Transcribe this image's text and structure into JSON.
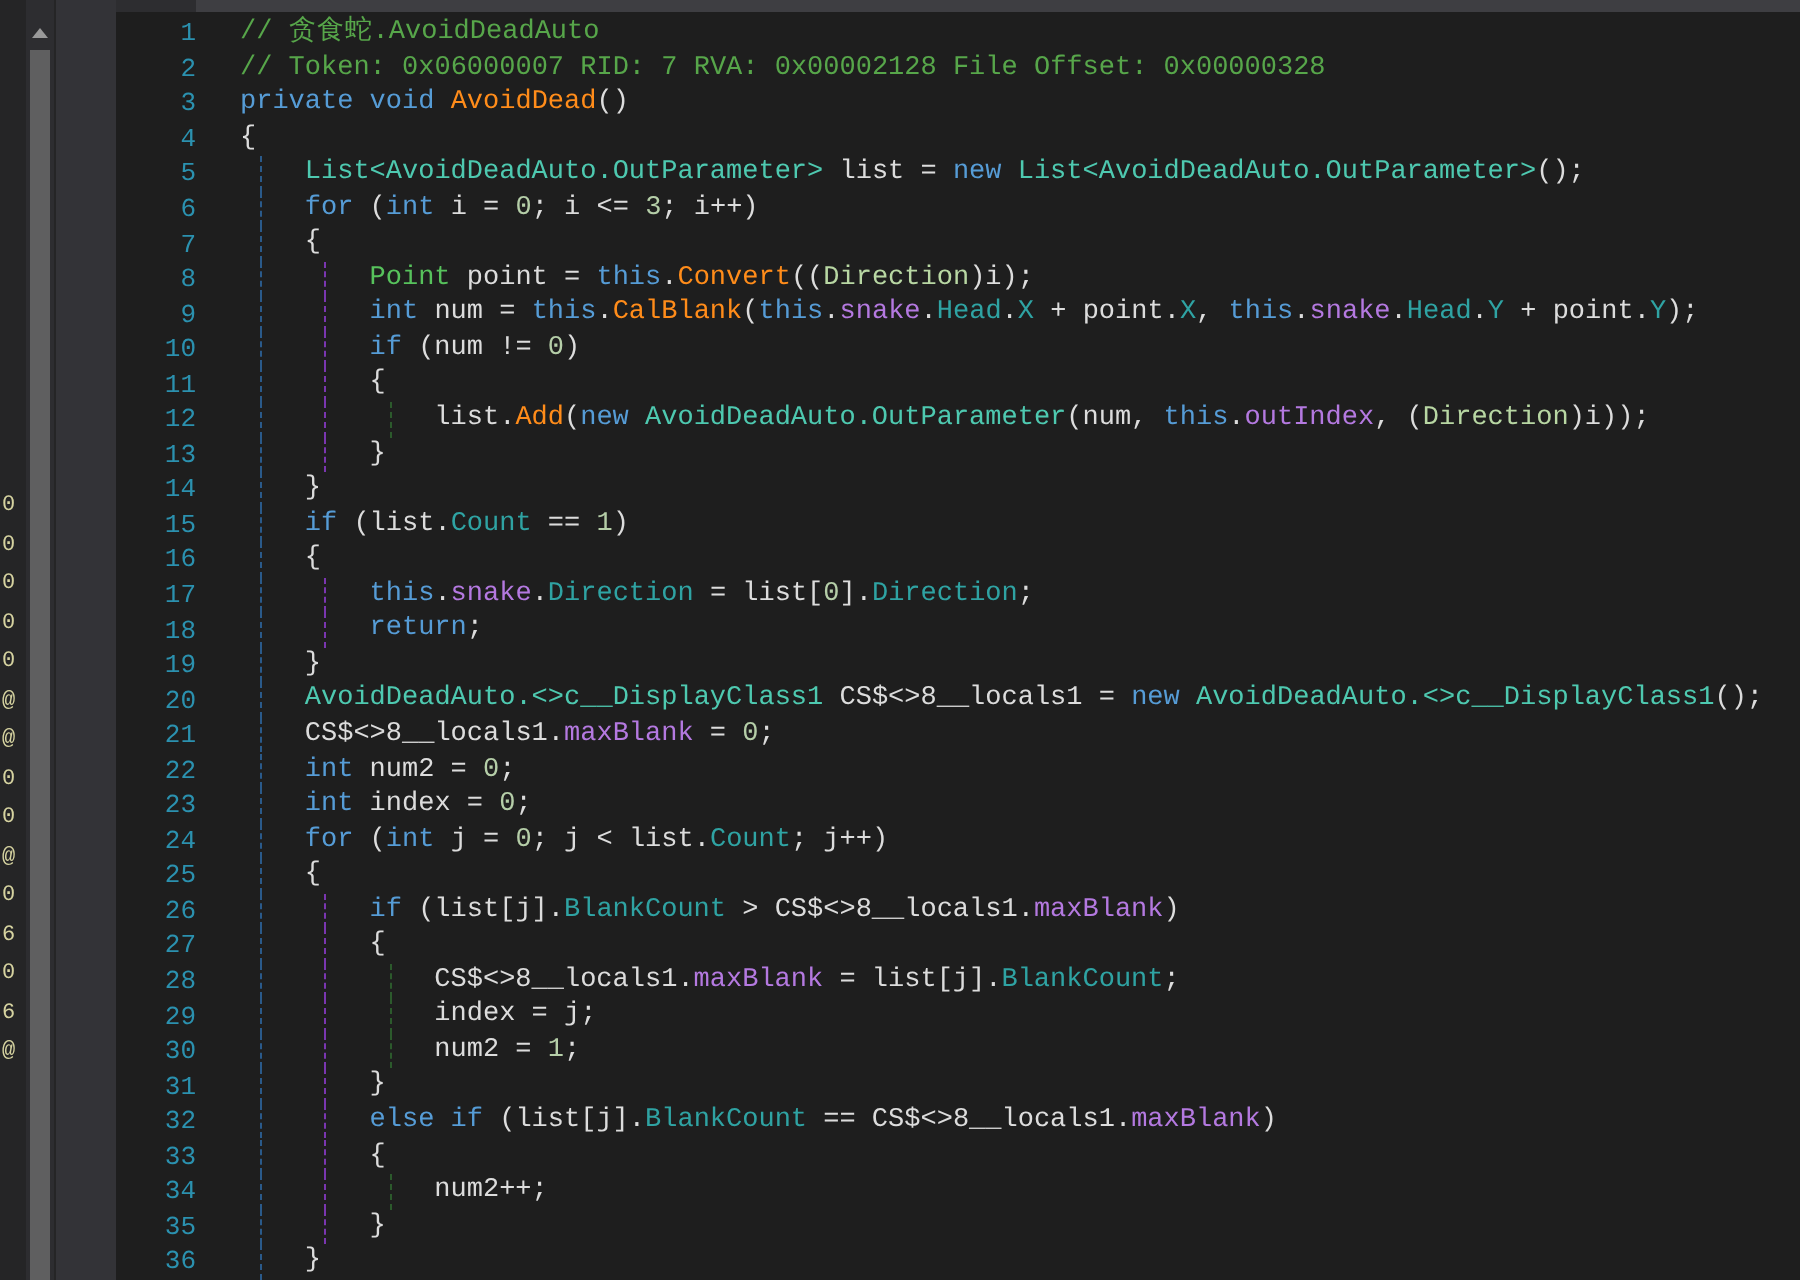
{
  "side_panel": {
    "fragments": [
      {
        "text": "0"
      },
      {
        "text": "0"
      },
      {
        "text": "0"
      },
      {
        "text": "0"
      },
      {
        "text": "0"
      },
      {
        "text": "@"
      },
      {
        "text": "@"
      },
      {
        "text": "0"
      },
      {
        "text": "0"
      },
      {
        "text": "@"
      },
      {
        "text": "0"
      },
      {
        "text": "6"
      },
      {
        "text": "0"
      },
      {
        "text": "6"
      },
      {
        "text": "@"
      }
    ]
  },
  "editor": {
    "lines": [
      {
        "number": "1",
        "tokens": [
          {
            "text": "// 贪食蛇.AvoidDeadAuto",
            "kind": "comment"
          }
        ]
      },
      {
        "number": "2",
        "tokens": [
          {
            "text": "// Token: 0x06000007 RID: 7 RVA: 0x00002128 File Offset: 0x00000328",
            "kind": "comment"
          }
        ]
      },
      {
        "number": "3",
        "tokens": [
          {
            "text": "private void ",
            "kind": "keyword"
          },
          {
            "text": "AvoidDead",
            "kind": "method"
          },
          {
            "text": "()",
            "kind": "plain"
          }
        ]
      },
      {
        "number": "4",
        "tokens": [
          {
            "text": "{",
            "kind": "plain"
          }
        ]
      },
      {
        "number": "5",
        "tokens": [
          {
            "text": "    List<AvoidDeadAuto.OutParameter>",
            "kind": "type"
          },
          {
            "text": " list = ",
            "kind": "plain"
          },
          {
            "text": "new ",
            "kind": "keyword"
          },
          {
            "text": "List<AvoidDeadAuto.OutParameter>",
            "kind": "type"
          },
          {
            "text": "();",
            "kind": "plain"
          }
        ]
      },
      {
        "number": "6",
        "tokens": [
          {
            "text": "    for",
            "kind": "keyword"
          },
          {
            "text": " (",
            "kind": "plain"
          },
          {
            "text": "int",
            "kind": "keyword"
          },
          {
            "text": " i = ",
            "kind": "plain"
          },
          {
            "text": "0",
            "kind": "number"
          },
          {
            "text": "; i <= ",
            "kind": "plain"
          },
          {
            "text": "3",
            "kind": "number"
          },
          {
            "text": "; i++)",
            "kind": "plain"
          }
        ]
      },
      {
        "number": "7",
        "tokens": [
          {
            "text": "    {",
            "kind": "plain"
          }
        ]
      },
      {
        "number": "8",
        "tokens": [
          {
            "text": "        Point",
            "kind": "struct"
          },
          {
            "text": " point = ",
            "kind": "plain"
          },
          {
            "text": "this",
            "kind": "keyword"
          },
          {
            "text": ".",
            "kind": "plain"
          },
          {
            "text": "Convert",
            "kind": "method"
          },
          {
            "text": "((",
            "kind": "plain"
          },
          {
            "text": "Direction",
            "kind": "enum"
          },
          {
            "text": ")i);",
            "kind": "plain"
          }
        ]
      },
      {
        "number": "9",
        "tokens": [
          {
            "text": "        int",
            "kind": "keyword"
          },
          {
            "text": " num = ",
            "kind": "plain"
          },
          {
            "text": "this",
            "kind": "keyword"
          },
          {
            "text": ".",
            "kind": "plain"
          },
          {
            "text": "CalBlank",
            "kind": "method"
          },
          {
            "text": "(",
            "kind": "plain"
          },
          {
            "text": "this",
            "kind": "keyword"
          },
          {
            "text": ".",
            "kind": "plain"
          },
          {
            "text": "snake",
            "kind": "field"
          },
          {
            "text": ".",
            "kind": "plain"
          },
          {
            "text": "Head",
            "kind": "property"
          },
          {
            "text": ".",
            "kind": "plain"
          },
          {
            "text": "X",
            "kind": "property"
          },
          {
            "text": " + point.",
            "kind": "plain"
          },
          {
            "text": "X",
            "kind": "property"
          },
          {
            "text": ", ",
            "kind": "plain"
          },
          {
            "text": "this",
            "kind": "keyword"
          },
          {
            "text": ".",
            "kind": "plain"
          },
          {
            "text": "snake",
            "kind": "field"
          },
          {
            "text": ".",
            "kind": "plain"
          },
          {
            "text": "Head",
            "kind": "property"
          },
          {
            "text": ".",
            "kind": "plain"
          },
          {
            "text": "Y",
            "kind": "property"
          },
          {
            "text": " + point.",
            "kind": "plain"
          },
          {
            "text": "Y",
            "kind": "property"
          },
          {
            "text": ");",
            "kind": "plain"
          }
        ]
      },
      {
        "number": "10",
        "tokens": [
          {
            "text": "        if",
            "kind": "keyword"
          },
          {
            "text": " (num != ",
            "kind": "plain"
          },
          {
            "text": "0",
            "kind": "number"
          },
          {
            "text": ")",
            "kind": "plain"
          }
        ]
      },
      {
        "number": "11",
        "tokens": [
          {
            "text": "        {",
            "kind": "plain"
          }
        ]
      },
      {
        "number": "12",
        "tokens": [
          {
            "text": "            list.",
            "kind": "plain"
          },
          {
            "text": "Add",
            "kind": "method"
          },
          {
            "text": "(",
            "kind": "plain"
          },
          {
            "text": "new ",
            "kind": "keyword"
          },
          {
            "text": "AvoidDeadAuto.OutParameter",
            "kind": "type"
          },
          {
            "text": "(num, ",
            "kind": "plain"
          },
          {
            "text": "this",
            "kind": "keyword"
          },
          {
            "text": ".",
            "kind": "plain"
          },
          {
            "text": "outIndex",
            "kind": "field"
          },
          {
            "text": ", (",
            "kind": "plain"
          },
          {
            "text": "Direction",
            "kind": "enum"
          },
          {
            "text": ")i));",
            "kind": "plain"
          }
        ]
      },
      {
        "number": "13",
        "tokens": [
          {
            "text": "        }",
            "kind": "plain"
          }
        ]
      },
      {
        "number": "14",
        "tokens": [
          {
            "text": "    }",
            "kind": "plain"
          }
        ]
      },
      {
        "number": "15",
        "tokens": [
          {
            "text": "    if",
            "kind": "keyword"
          },
          {
            "text": " (list.",
            "kind": "plain"
          },
          {
            "text": "Count",
            "kind": "property"
          },
          {
            "text": " == ",
            "kind": "plain"
          },
          {
            "text": "1",
            "kind": "number"
          },
          {
            "text": ")",
            "kind": "plain"
          }
        ]
      },
      {
        "number": "16",
        "tokens": [
          {
            "text": "    {",
            "kind": "plain"
          }
        ]
      },
      {
        "number": "17",
        "tokens": [
          {
            "text": "        this",
            "kind": "keyword"
          },
          {
            "text": ".",
            "kind": "plain"
          },
          {
            "text": "snake",
            "kind": "field"
          },
          {
            "text": ".",
            "kind": "plain"
          },
          {
            "text": "Direction",
            "kind": "property"
          },
          {
            "text": " = list[",
            "kind": "plain"
          },
          {
            "text": "0",
            "kind": "number"
          },
          {
            "text": "].",
            "kind": "plain"
          },
          {
            "text": "Direction",
            "kind": "property"
          },
          {
            "text": ";",
            "kind": "plain"
          }
        ]
      },
      {
        "number": "18",
        "tokens": [
          {
            "text": "        return",
            "kind": "keyword"
          },
          {
            "text": ";",
            "kind": "plain"
          }
        ]
      },
      {
        "number": "19",
        "tokens": [
          {
            "text": "    }",
            "kind": "plain"
          }
        ]
      },
      {
        "number": "20",
        "tokens": [
          {
            "text": "    AvoidDeadAuto.<>c__DisplayClass1",
            "kind": "type"
          },
          {
            "text": " CS$<>8__locals1 = ",
            "kind": "plain"
          },
          {
            "text": "new ",
            "kind": "keyword"
          },
          {
            "text": "AvoidDeadAuto.<>c__DisplayClass1",
            "kind": "type"
          },
          {
            "text": "();",
            "kind": "plain"
          }
        ]
      },
      {
        "number": "21",
        "tokens": [
          {
            "text": "    CS$<>8__locals1.",
            "kind": "plain"
          },
          {
            "text": "maxBlank",
            "kind": "field"
          },
          {
            "text": " = ",
            "kind": "plain"
          },
          {
            "text": "0",
            "kind": "number"
          },
          {
            "text": ";",
            "kind": "plain"
          }
        ]
      },
      {
        "number": "22",
        "tokens": [
          {
            "text": "    int",
            "kind": "keyword"
          },
          {
            "text": " num2 = ",
            "kind": "plain"
          },
          {
            "text": "0",
            "kind": "number"
          },
          {
            "text": ";",
            "kind": "plain"
          }
        ]
      },
      {
        "number": "23",
        "tokens": [
          {
            "text": "    int",
            "kind": "keyword"
          },
          {
            "text": " index = ",
            "kind": "plain"
          },
          {
            "text": "0",
            "kind": "number"
          },
          {
            "text": ";",
            "kind": "plain"
          }
        ]
      },
      {
        "number": "24",
        "tokens": [
          {
            "text": "    for",
            "kind": "keyword"
          },
          {
            "text": " (",
            "kind": "plain"
          },
          {
            "text": "int",
            "kind": "keyword"
          },
          {
            "text": " j = ",
            "kind": "plain"
          },
          {
            "text": "0",
            "kind": "number"
          },
          {
            "text": "; j < list.",
            "kind": "plain"
          },
          {
            "text": "Count",
            "kind": "property"
          },
          {
            "text": "; j++)",
            "kind": "plain"
          }
        ]
      },
      {
        "number": "25",
        "tokens": [
          {
            "text": "    {",
            "kind": "plain"
          }
        ]
      },
      {
        "number": "26",
        "tokens": [
          {
            "text": "        if",
            "kind": "keyword"
          },
          {
            "text": " (list[j].",
            "kind": "plain"
          },
          {
            "text": "BlankCount",
            "kind": "property"
          },
          {
            "text": " > CS$<>8__locals1.",
            "kind": "plain"
          },
          {
            "text": "maxBlank",
            "kind": "field"
          },
          {
            "text": ")",
            "kind": "plain"
          }
        ]
      },
      {
        "number": "27",
        "tokens": [
          {
            "text": "        {",
            "kind": "plain"
          }
        ]
      },
      {
        "number": "28",
        "tokens": [
          {
            "text": "            CS$<>8__locals1.",
            "kind": "plain"
          },
          {
            "text": "maxBlank",
            "kind": "field"
          },
          {
            "text": " = list[j].",
            "kind": "plain"
          },
          {
            "text": "BlankCount",
            "kind": "property"
          },
          {
            "text": ";",
            "kind": "plain"
          }
        ]
      },
      {
        "number": "29",
        "tokens": [
          {
            "text": "            index = j;",
            "kind": "plain"
          }
        ]
      },
      {
        "number": "30",
        "tokens": [
          {
            "text": "            num2 = ",
            "kind": "plain"
          },
          {
            "text": "1",
            "kind": "number"
          },
          {
            "text": ";",
            "kind": "plain"
          }
        ]
      },
      {
        "number": "31",
        "tokens": [
          {
            "text": "        }",
            "kind": "plain"
          }
        ]
      },
      {
        "number": "32",
        "tokens": [
          {
            "text": "        else if",
            "kind": "keyword"
          },
          {
            "text": " (list[j].",
            "kind": "plain"
          },
          {
            "text": "BlankCount",
            "kind": "property"
          },
          {
            "text": " == CS$<>8__locals1.",
            "kind": "plain"
          },
          {
            "text": "maxBlank",
            "kind": "field"
          },
          {
            "text": ")",
            "kind": "plain"
          }
        ]
      },
      {
        "number": "33",
        "tokens": [
          {
            "text": "        {",
            "kind": "plain"
          }
        ]
      },
      {
        "number": "34",
        "tokens": [
          {
            "text": "            num2++;",
            "kind": "plain"
          }
        ]
      },
      {
        "number": "35",
        "tokens": [
          {
            "text": "        }",
            "kind": "plain"
          }
        ]
      },
      {
        "number": "36",
        "tokens": [
          {
            "text": "    }",
            "kind": "plain"
          }
        ]
      }
    ]
  }
}
